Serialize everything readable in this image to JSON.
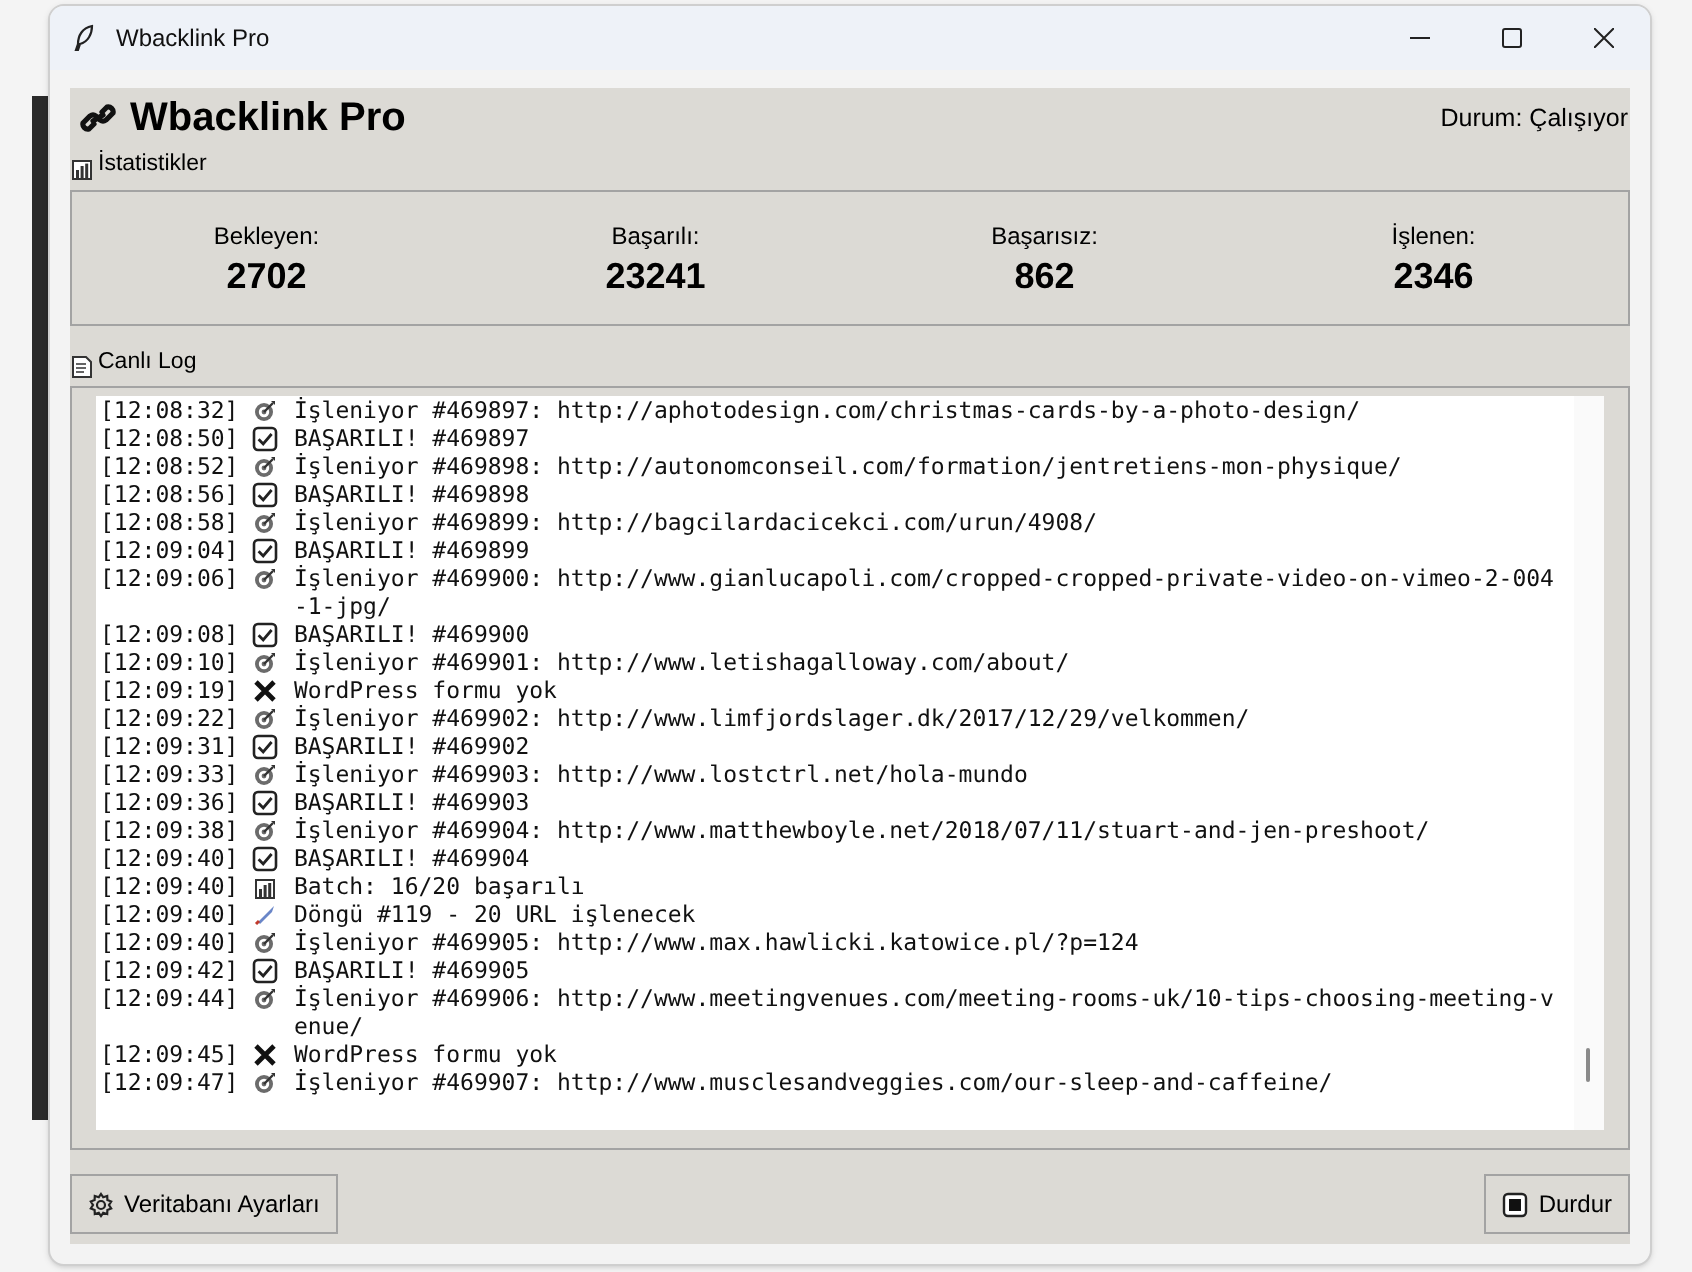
{
  "window": {
    "title": "Wbacklink Pro"
  },
  "header": {
    "title": "Wbacklink Pro",
    "status": "Durum: Çalışıyor"
  },
  "stats": {
    "label": "İstatistikler",
    "items": [
      {
        "label": "Bekleyen:",
        "value": "2702"
      },
      {
        "label": "Başarılı:",
        "value": "23241"
      },
      {
        "label": "Başarısız:",
        "value": "862"
      },
      {
        "label": "İşlenen:",
        "value": "2346"
      }
    ]
  },
  "log": {
    "label": "Canlı Log",
    "entries": [
      {
        "time": "[12:08:32]",
        "kind": "processing",
        "text": "İşleniyor #469897: http://aphotodesign.com/christmas-cards-by-a-photo-design/"
      },
      {
        "time": "[12:08:50]",
        "kind": "success",
        "text": "BAŞARILI! #469897"
      },
      {
        "time": "[12:08:52]",
        "kind": "processing",
        "text": "İşleniyor #469898: http://autonomconseil.com/formation/jentretiens-mon-physique/"
      },
      {
        "time": "[12:08:56]",
        "kind": "success",
        "text": "BAŞARILI! #469898"
      },
      {
        "time": "[12:08:58]",
        "kind": "processing",
        "text": "İşleniyor #469899: http://bagcilardacicekci.com/urun/4908/"
      },
      {
        "time": "[12:09:04]",
        "kind": "success",
        "text": "BAŞARILI! #469899"
      },
      {
        "time": "[12:09:06]",
        "kind": "processing",
        "text": "İşleniyor #469900: http://www.gianlucapoli.com/cropped-cropped-private-video-on-vimeo-2-004-1-jpg/"
      },
      {
        "time": "[12:09:08]",
        "kind": "success",
        "text": "BAŞARILI! #469900"
      },
      {
        "time": "[12:09:10]",
        "kind": "processing",
        "text": "İşleniyor #469901: http://www.letishagalloway.com/about/"
      },
      {
        "time": "[12:09:19]",
        "kind": "error",
        "text": "WordPress formu yok"
      },
      {
        "time": "[12:09:22]",
        "kind": "processing",
        "text": "İşleniyor #469902: http://www.limfjordslager.dk/2017/12/29/velkommen/"
      },
      {
        "time": "[12:09:31]",
        "kind": "success",
        "text": "BAŞARILI! #469902"
      },
      {
        "time": "[12:09:33]",
        "kind": "processing",
        "text": "İşleniyor #469903: http://www.lostctrl.net/hola-mundo"
      },
      {
        "time": "[12:09:36]",
        "kind": "success",
        "text": "BAŞARILI! #469903"
      },
      {
        "time": "[12:09:38]",
        "kind": "processing",
        "text": "İşleniyor #469904: http://www.matthewboyle.net/2018/07/11/stuart-and-jen-preshoot/"
      },
      {
        "time": "[12:09:40]",
        "kind": "success",
        "text": "BAŞARILI! #469904"
      },
      {
        "time": "[12:09:40]",
        "kind": "stats",
        "text": "Batch: 16/20 başarılı"
      },
      {
        "time": "[12:09:40]",
        "kind": "cycle",
        "text": "Döngü #119 - 20 URL işlenecek"
      },
      {
        "time": "[12:09:40]",
        "kind": "processing",
        "text": "İşleniyor #469905: http://www.max.hawlicki.katowice.pl/?p=124"
      },
      {
        "time": "[12:09:42]",
        "kind": "success",
        "text": "BAŞARILI! #469905"
      },
      {
        "time": "[12:09:44]",
        "kind": "processing",
        "text": "İşleniyor #469906: http://www.meetingvenues.com/meeting-rooms-uk/10-tips-choosing-meeting-venue/"
      },
      {
        "time": "[12:09:45]",
        "kind": "error",
        "text": "WordPress formu yok"
      },
      {
        "time": "[12:09:47]",
        "kind": "processing",
        "text": "İşleniyor #469907: http://www.musclesandveggies.com/our-sleep-and-caffeine/"
      }
    ]
  },
  "buttons": [
    {
      "kind": "settings",
      "label": "Veritabanı Ayarları"
    },
    {
      "kind": "stop",
      "label": "Durdur"
    }
  ]
}
